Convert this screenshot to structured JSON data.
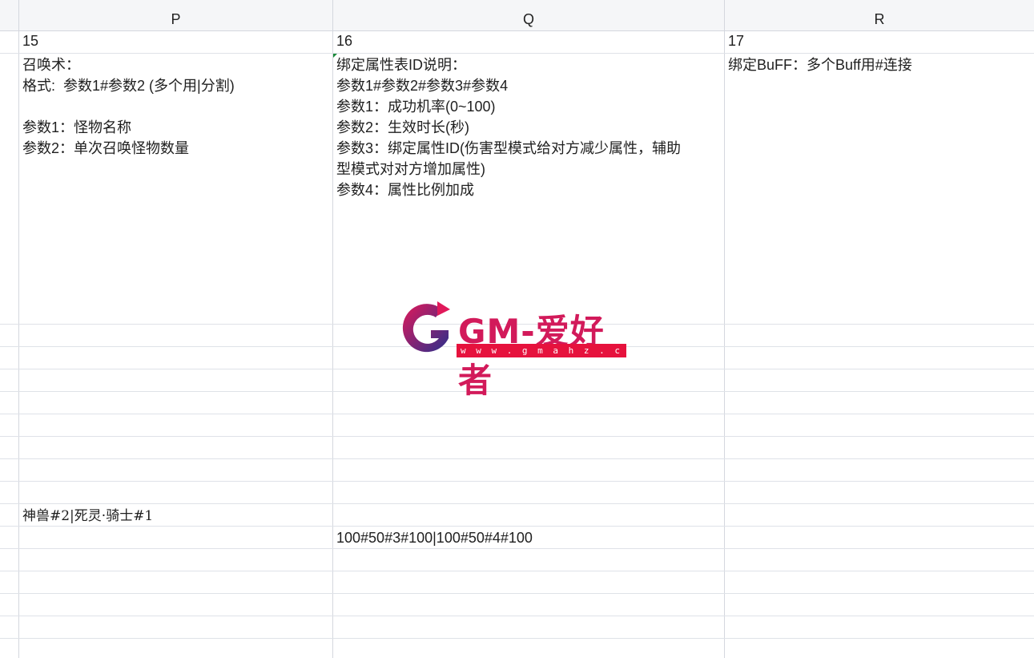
{
  "columns": [
    "P",
    "Q",
    "R"
  ],
  "rows": {
    "header_row": [
      "15",
      "16",
      "17"
    ],
    "desc_row": {
      "p": "召唤术：\n格式:  参数1#参数2 (多个用|分割)\n\n参数1：怪物名称\n参数2：单次召唤怪物数量",
      "q": "绑定属性表ID说明：\n参数1#参数2#参数3#参数4\n参数1：成功机率(0~100)\n参数2：生效时长(秒)\n参数3：绑定属性ID(伤害型模式给对方减少属性，辅助\n型模式对对方增加属性)\n参数4：属性比例加成",
      "r": "绑定BuFF：多个Buff用#连接"
    },
    "value_row_1": {
      "p": "神兽#2|死灵·骑士#1"
    },
    "value_row_2": {
      "q": "100#50#3#100|100#50#4#100"
    }
  },
  "watermark": {
    "text": "GM-爱好者",
    "url": "w w w . g m a h z . c o m"
  },
  "colors": {
    "watermark_pink": "#d21a5a",
    "watermark_blue": "#2b2f8c",
    "grid": "#d4d7de"
  }
}
